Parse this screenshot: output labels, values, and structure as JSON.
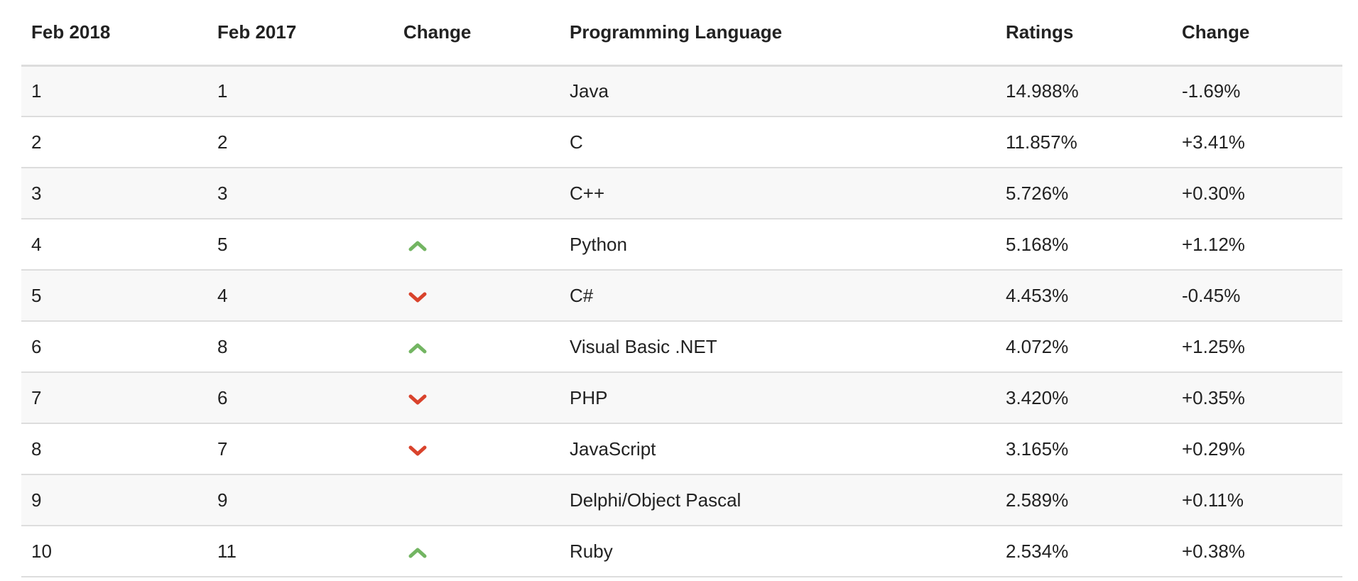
{
  "headers": [
    "Feb 2018",
    "Feb 2017",
    "Change",
    "Programming Language",
    "Ratings",
    "Change"
  ],
  "colors": {
    "up": "#73b562",
    "down": "#d9432c"
  },
  "rows": [
    {
      "rank_2018": "1",
      "rank_2017": "1",
      "trend": "none",
      "language": "Java",
      "rating": "14.988%",
      "change": "-1.69%"
    },
    {
      "rank_2018": "2",
      "rank_2017": "2",
      "trend": "none",
      "language": "C",
      "rating": "11.857%",
      "change": "+3.41%"
    },
    {
      "rank_2018": "3",
      "rank_2017": "3",
      "trend": "none",
      "language": "C++",
      "rating": "5.726%",
      "change": "+0.30%"
    },
    {
      "rank_2018": "4",
      "rank_2017": "5",
      "trend": "up",
      "language": "Python",
      "rating": "5.168%",
      "change": "+1.12%"
    },
    {
      "rank_2018": "5",
      "rank_2017": "4",
      "trend": "down",
      "language": "C#",
      "rating": "4.453%",
      "change": "-0.45%"
    },
    {
      "rank_2018": "6",
      "rank_2017": "8",
      "trend": "up",
      "language": "Visual Basic .NET",
      "rating": "4.072%",
      "change": "+1.25%"
    },
    {
      "rank_2018": "7",
      "rank_2017": "6",
      "trend": "down",
      "language": "PHP",
      "rating": "3.420%",
      "change": "+0.35%"
    },
    {
      "rank_2018": "8",
      "rank_2017": "7",
      "trend": "down",
      "language": "JavaScript",
      "rating": "3.165%",
      "change": "+0.29%"
    },
    {
      "rank_2018": "9",
      "rank_2017": "9",
      "trend": "none",
      "language": "Delphi/Object Pascal",
      "rating": "2.589%",
      "change": "+0.11%"
    },
    {
      "rank_2018": "10",
      "rank_2017": "11",
      "trend": "up",
      "language": "Ruby",
      "rating": "2.534%",
      "change": "+0.38%"
    }
  ]
}
